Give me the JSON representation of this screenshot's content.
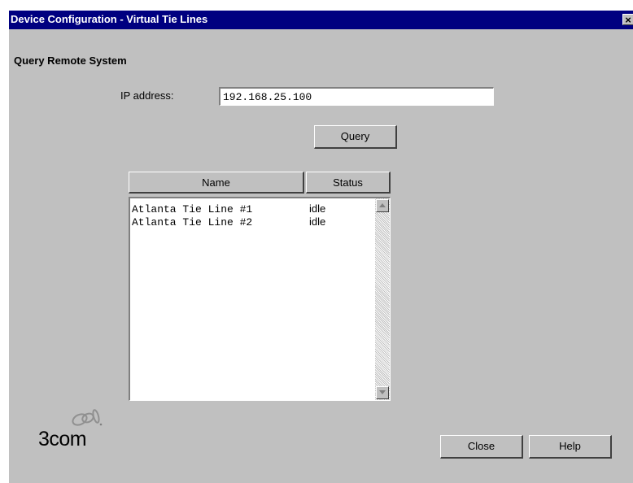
{
  "window": {
    "title": "Device Configuration - Virtual Tie Lines",
    "close_glyph": "×"
  },
  "section": {
    "title": "Query Remote System"
  },
  "ip": {
    "label": "IP address:",
    "value": "192.168.25.100"
  },
  "buttons": {
    "query": "Query",
    "close": "Close",
    "help": "Help"
  },
  "table": {
    "columns": [
      "Name",
      "Status"
    ],
    "rows": [
      {
        "name": "Atlanta Tie Line #1",
        "status": "idle"
      },
      {
        "name": "Atlanta Tie Line #2",
        "status": "idle"
      }
    ]
  },
  "logo": {
    "text": "3com",
    "icon": "3com-chain-logo-icon"
  },
  "colors": {
    "titlebar": "#000080",
    "dialog_bg": "#c0c0c0"
  }
}
